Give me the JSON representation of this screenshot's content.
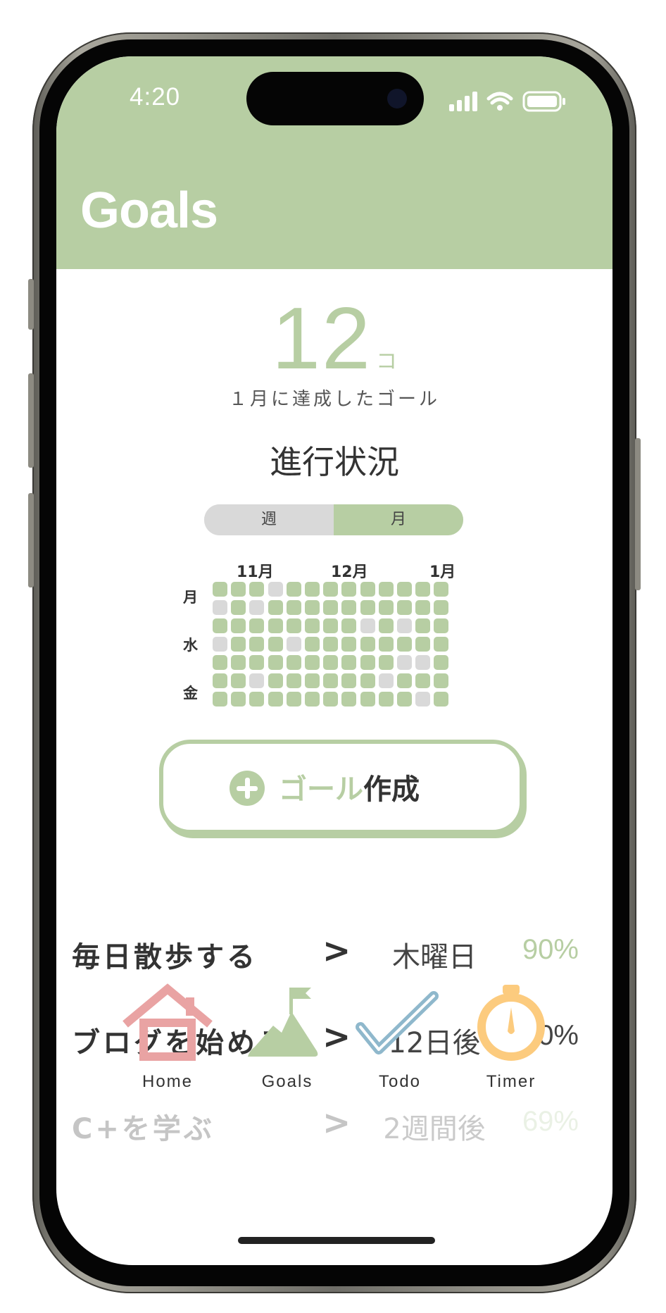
{
  "status_bar": {
    "time": "4:20"
  },
  "header": {
    "title": "Goals"
  },
  "summary": {
    "count": "12",
    "unit": "コ",
    "caption": "１月に達成したゴール"
  },
  "progress": {
    "title": "進行状況",
    "toggle": {
      "week_label": "週",
      "month_label": "月",
      "selected": "月"
    },
    "months": [
      "11月",
      "12月",
      "1月"
    ],
    "day_labels": [
      "月",
      "水",
      "金"
    ],
    "grid_rows": [
      "1110111111111",
      "0101111111111",
      "1111111101011",
      "0111011111111",
      "1111111111001",
      "1101111110111",
      "1111111111101"
    ]
  },
  "create_button": {
    "accent_label": "ゴール",
    "main_label": "作成"
  },
  "goals": [
    {
      "name": "毎日散歩する",
      "due": "木曜日",
      "percent": "90%",
      "percent_color": "#b7cea3"
    },
    {
      "name": "ブログを始める",
      "due": "12日後",
      "percent": "0%",
      "percent_color": "#444444"
    },
    {
      "name": "C+を学ぶ",
      "due": "2週間後",
      "percent": "69%",
      "percent_color": "#b7cea3"
    }
  ],
  "tabbar": {
    "items": [
      {
        "label": "Home",
        "icon": "house-icon",
        "color": "#e9a3a3"
      },
      {
        "label": "Goals",
        "icon": "mountain-flag-icon",
        "color": "#b7cea3"
      },
      {
        "label": "Todo",
        "icon": "checkmark-icon",
        "color": "#8fb8cc"
      },
      {
        "label": "Timer",
        "icon": "stopwatch-icon",
        "color": "#fccb7e"
      }
    ]
  },
  "colors": {
    "accent": "#b7cea3",
    "cell_on": "#b7cea3",
    "cell_off": "#d9d9d9"
  }
}
